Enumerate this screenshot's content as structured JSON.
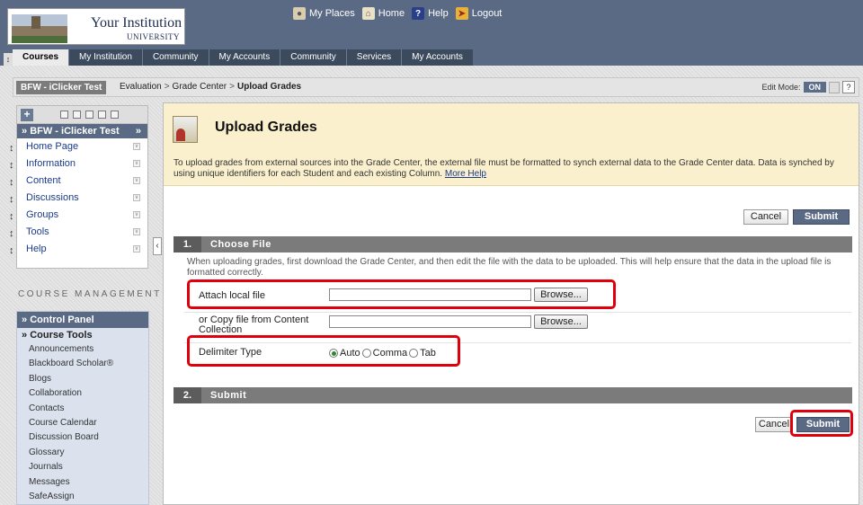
{
  "header": {
    "logo": {
      "name": "Your Institution",
      "sub": "UNIVERSITY"
    },
    "top_links": [
      {
        "label": "My Places",
        "icon": "person-icon"
      },
      {
        "label": "Home",
        "icon": "home-icon"
      },
      {
        "label": "Help",
        "icon": "help-icon"
      },
      {
        "label": "Logout",
        "icon": "logout-icon"
      }
    ],
    "tabs": [
      "Courses",
      "My Institution",
      "Community",
      "My Accounts",
      "Community",
      "Services",
      "My Accounts"
    ]
  },
  "breadcrumb": {
    "course": "BFW - iClicker Test",
    "path": [
      "Evaluation",
      "Grade Center",
      "Upload Grades"
    ],
    "separator": ">",
    "edit_mode_label": "Edit Mode:",
    "edit_mode_value": "ON",
    "help": "?"
  },
  "course_menu": {
    "add": "+",
    "title": "BFW - iClicker Test",
    "title_prefix": "»",
    "title_suffix": "»",
    "items": [
      "Home Page",
      "Information",
      "Content",
      "Discussions",
      "Groups",
      "Tools",
      "Help"
    ]
  },
  "course_management": {
    "heading": "COURSE MANAGEMENT",
    "panel_title": "Control Panel",
    "section": "Course Tools",
    "items": [
      "Announcements",
      "Blackboard Scholar®",
      "Blogs",
      "Collaboration",
      "Contacts",
      "Course Calendar",
      "Discussion Board",
      "Glossary",
      "Journals",
      "Messages",
      "SafeAssign"
    ]
  },
  "page": {
    "title": "Upload Grades",
    "description": "To upload grades from external sources into the Grade Center, the external file must be formatted to synch external data to the Grade Center data. Data is synched by using unique identifiers for each Student and each existing Column.",
    "more_help": "More Help",
    "cancel": "Cancel",
    "submit": "Submit"
  },
  "step1": {
    "number": "1.",
    "title": "Choose File",
    "instructions": "When uploading grades, first download the Grade Center, and then edit the file with the data to be uploaded. This will help ensure that the data in the upload file is formatted correctly.",
    "attach_label": "Attach local file",
    "attach_value": "",
    "copy_label": "or Copy file from Content Collection",
    "copy_value": "",
    "browse": "Browse...",
    "delimiter_label": "Delimiter Type",
    "delimiter_options": [
      "Auto",
      "Comma",
      "Tab"
    ],
    "delimiter_selected": "Auto"
  },
  "step2": {
    "number": "2.",
    "title": "Submit"
  },
  "colors": {
    "header": "#5a6a84",
    "page_head": "#fbf0cd",
    "step_bar": "#7b7b7b",
    "highlight": "#e0000b"
  }
}
